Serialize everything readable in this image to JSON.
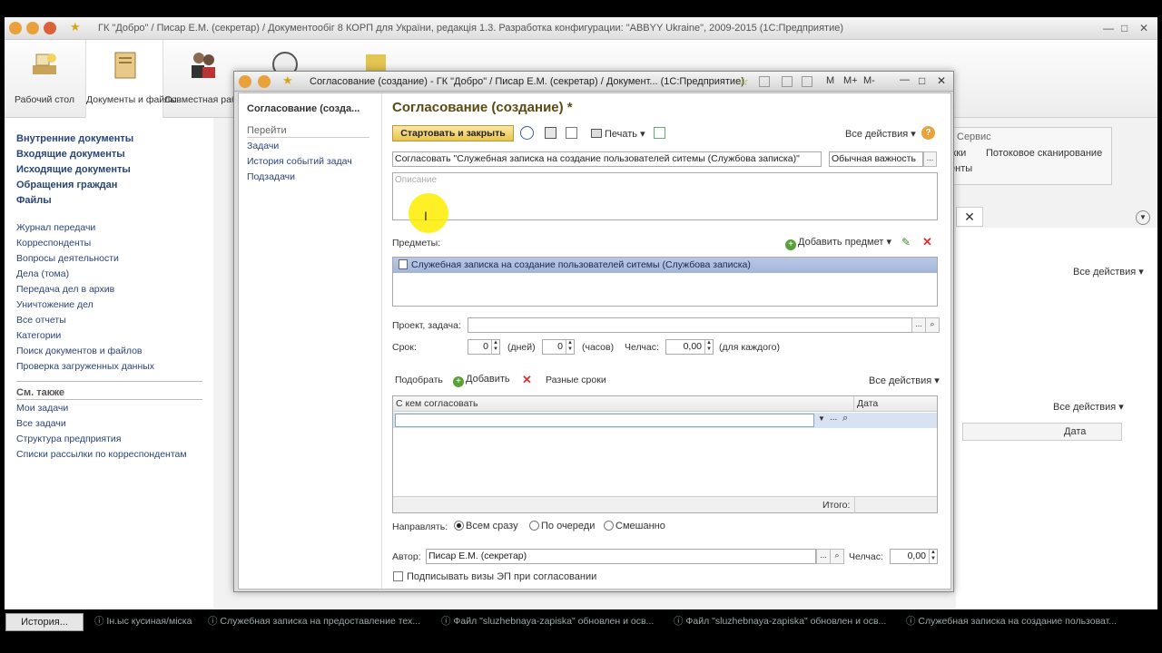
{
  "app": {
    "title": "ГК \"Добро\" / Писар Е.М. (секретар) / Документообіг 8 КОРП для України, редакція 1.3. Разработка конфигурации: \"ABBYY Ukraine\", 2009-2015  (1С:Предприятие)"
  },
  "sections": [
    {
      "label": "Рабочий стол",
      "icon": "desk-icon"
    },
    {
      "label": "Документы и файлы",
      "icon": "documents-icon"
    },
    {
      "label": "Совместная работа",
      "icon": "collaboration-icon"
    },
    {
      "label": "",
      "icon": "clock-icon"
    },
    {
      "label": "",
      "icon": "database-icon"
    }
  ],
  "leftnav": {
    "bold_items": [
      "Внутренние документы",
      "Входящие документы",
      "Исходящие документы",
      "Обращения граждан",
      "Файлы"
    ],
    "items": [
      "Журнал передачи",
      "Корреспонденты",
      "Вопросы деятельности",
      "Дела (тома)",
      "Передача дел в архив",
      "Уничтожение дел",
      "Все отчеты",
      "Категории",
      "Поиск документов и файлов",
      "Проверка загруженных данных"
    ],
    "see_also_title": "См. также",
    "see_also": [
      "Мои задачи",
      "Все задачи",
      "Структура предприятия",
      "Списки рассылки по корреспондентам"
    ]
  },
  "background": {
    "service_label": "Сервис",
    "stream_scan": "Потоковое сканирование",
    "partial1": "жки",
    "partial2": "енты",
    "all_actions": "Все действия",
    "all_actions2": "Все действия",
    "date_col": "Дата"
  },
  "dialog": {
    "title": "Согласование (создание) - ГК \"Добро\" / Писар Е.М. (секретар) / Документ...  (1С:Предприятие)",
    "nav_title": "Согласование (созда...",
    "nav_goto": "Перейти",
    "nav_links": [
      "Задачи",
      "История событий задач",
      "Подзадачи"
    ],
    "form_title": "Согласование (создание) *",
    "start_close": "Стартовать и закрыть",
    "print": "Печать",
    "all_actions": "Все действия",
    "subject": "Согласовать \"Служебная записка на создание пользователей ситемы (Службова записка)\"",
    "importance": "Обычная важность",
    "description_placeholder": "Описание",
    "items_label": "Предметы:",
    "add_item": "Добавить предмет",
    "item_row": "Служебная записка на создание пользователей ситемы (Службова записка)",
    "project_label": "Проект, задача:",
    "term_label": "Срок:",
    "days_value": "0",
    "days_unit": "(дней)",
    "hours_value": "0",
    "hours_unit": "(часов)",
    "manhours_label": "Челчас:",
    "manhours_value": "0,00",
    "per_each": "(для каждого)",
    "pick": "Подобрать",
    "add": "Добавить",
    "diff_terms": "Разные сроки",
    "all_actions_grid": "Все действия",
    "col_with_whom": "С кем согласовать",
    "col_date": "Дата",
    "total_label": "Итого:",
    "direction_label": "Направлять:",
    "dir_all": "Всем сразу",
    "dir_queue": "По очереди",
    "dir_mixed": "Смешанно",
    "author_label": "Автор:",
    "author_value": "Писар Е.М. (секретар)",
    "author_hours_label": "Челчас:",
    "author_hours_value": "0,00",
    "sign_label": "Подписывать визы ЭП при согласовании"
  },
  "taskbar": {
    "history": "История...",
    "items": [
      "Ін.ыс кусиная/міска",
      "Служебная записка на предоставление тех...",
      "Файл \"sluzhebnaya-zapiska\" обновлен и осв...",
      "Файл \"sluzhebnaya-zapiska\" обновлен и осв...",
      "Служебная записка на создание пользоват..."
    ]
  }
}
